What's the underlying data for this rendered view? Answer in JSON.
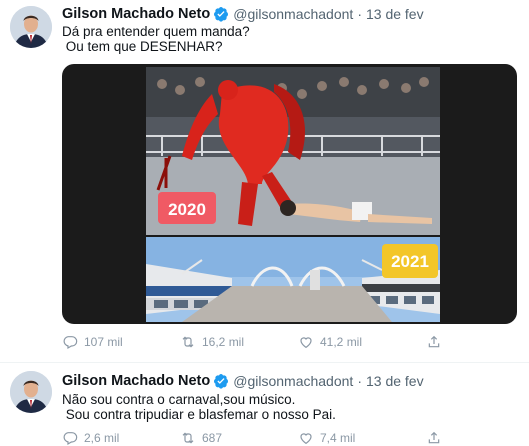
{
  "tweets": [
    {
      "author": "Gilson Machado Neto",
      "handle": "@gilsonmachadont",
      "separator": "·",
      "date": "13 de fev",
      "lines": [
        "Dá pra entender quem manda?",
        " Ou tem que DESENHAR?"
      ],
      "media": {
        "badge_top": "2020",
        "badge_bottom": "2021"
      },
      "actions": {
        "replies": "107 mil",
        "retweets": "16,2 mil",
        "likes": "41,2 mil"
      }
    },
    {
      "author": "Gilson Machado Neto",
      "handle": "@gilsonmachadont",
      "separator": "·",
      "date": "13 de fev",
      "lines": [
        "Não sou contra o carnaval,sou músico.",
        " Sou contra tripudiar e blasfemar o nosso Pai."
      ],
      "actions": {
        "replies": "2,6 mil",
        "retweets": "687",
        "likes": "7,4 mil"
      }
    }
  ],
  "colors": {
    "verified": "#1d9bf0",
    "secondary_text": "#536471",
    "icon": "#8b98a5"
  },
  "icons": [
    "verified-icon",
    "reply-icon",
    "retweet-icon",
    "like-icon",
    "share-icon"
  ]
}
